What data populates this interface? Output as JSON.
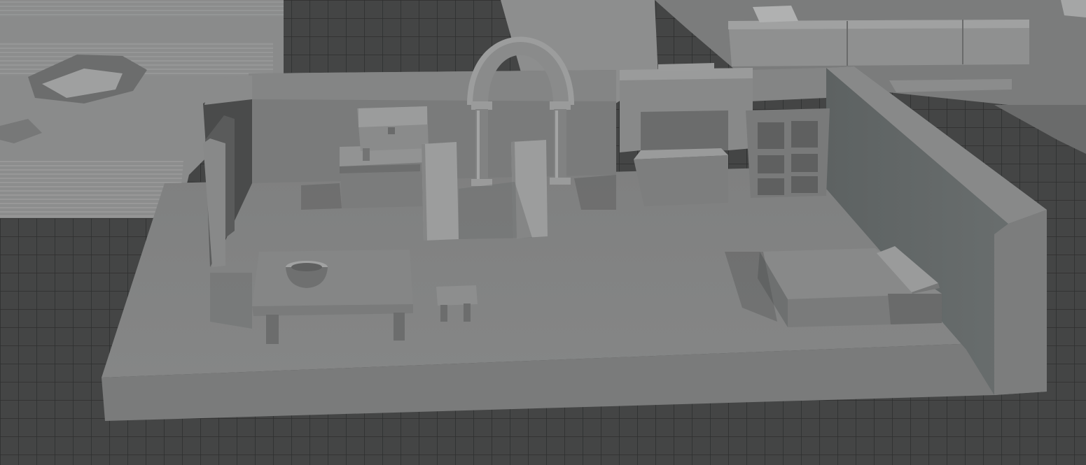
{
  "viewport": {
    "background": "#3a3a3a",
    "grid_color": "#4a4a4a",
    "grid_line": "#2c2c2c"
  },
  "scene": {
    "objects": [
      "floor-platform",
      "back-wall",
      "left-wall",
      "right-wall",
      "stone-arch",
      "chest",
      "dresser",
      "fireplace",
      "shelf-unit",
      "table",
      "bowl",
      "stool",
      "bed",
      "door-panels"
    ],
    "material": {
      "base": "#7d7e7e",
      "light": "#9a9b9b",
      "shadow": "#5f6060",
      "dark": "#3f4040"
    }
  }
}
